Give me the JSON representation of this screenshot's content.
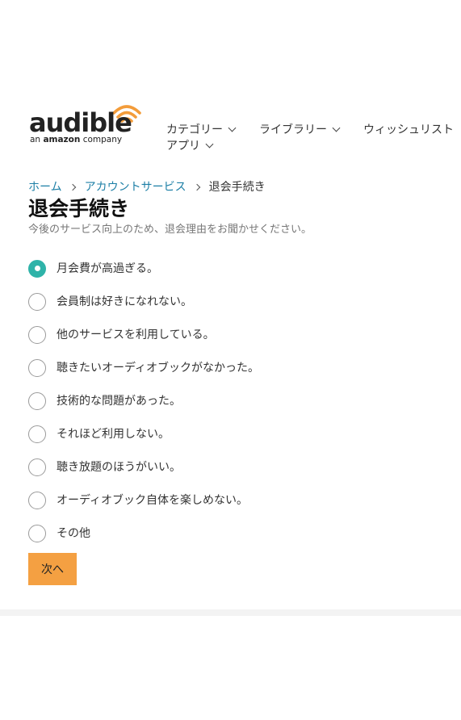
{
  "logo": {
    "word": "audible",
    "tagline_prefix": "an",
    "tagline_brand": "amazon",
    "tagline_suffix": "company",
    "colors": {
      "word": "#222222",
      "waves": "#f39c3a"
    }
  },
  "nav": {
    "items": [
      {
        "label": "カテゴリー",
        "has_chevron": true
      },
      {
        "label": "ライブラリー",
        "has_chevron": true
      },
      {
        "label": "ウィッシュリスト",
        "has_chevron": false
      },
      {
        "label": "アプリ",
        "has_chevron": true
      }
    ]
  },
  "breadcrumb": {
    "items": [
      {
        "label": "ホーム",
        "link": true
      },
      {
        "label": "アカウントサービス",
        "link": true
      },
      {
        "label": "退会手続き",
        "link": false
      }
    ]
  },
  "page": {
    "title": "退会手続き",
    "subtitle": "今後のサービス向上のため、退会理由をお聞かせください。"
  },
  "reasons": {
    "selected_index": 0,
    "options": [
      "月会費が高過ぎる。",
      "会員制は好きになれない。",
      "他のサービスを利用している。",
      "聴きたいオーディオブックがなかった。",
      "技術的な問題があった。",
      "それほど利用しない。",
      "聴き放題のほうがいい。",
      "オーディオブック自体を楽しめない。",
      "その他"
    ]
  },
  "actions": {
    "next_label": "次へ"
  },
  "colors": {
    "accent_radio": "#2fb3a9",
    "link": "#1d7fa6",
    "primary_button": "#f4a042"
  }
}
